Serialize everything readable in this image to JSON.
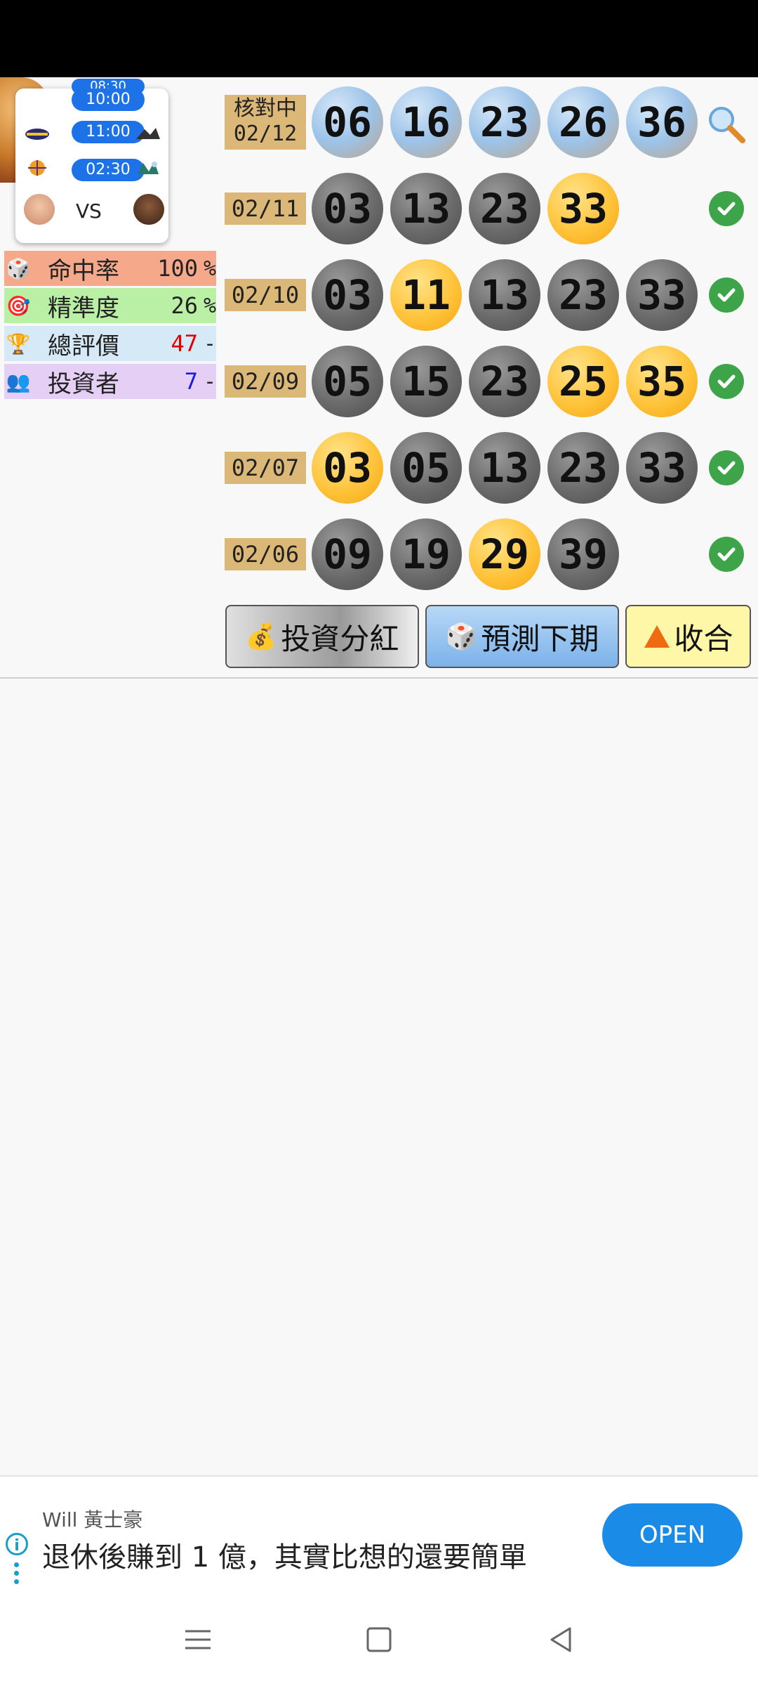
{
  "schedule": {
    "times": [
      "08:30",
      "10:00",
      "11:00",
      "02:30"
    ],
    "vs_label": "VS"
  },
  "stats": [
    {
      "icon": "dice-icon",
      "label": "命中率",
      "value": "100",
      "unit": "%",
      "bg": "#f6a88a",
      "value_color": "#222222"
    },
    {
      "icon": "target-icon",
      "label": "精準度",
      "value": "26",
      "unit": "%",
      "bg": "#b9f0a6",
      "value_color": "#222222"
    },
    {
      "icon": "trophy-icon",
      "label": "總評價",
      "value": "47",
      "unit": "-",
      "bg": "#d6e9f7",
      "value_color": "#e00000"
    },
    {
      "icon": "people-icon",
      "label": "投資者",
      "value": "7",
      "unit": "-",
      "bg": "#e6cff4",
      "value_color": "#1a1adc"
    }
  ],
  "draws": [
    {
      "date_top": "核對中",
      "date": "02/12",
      "balls": [
        "06",
        "16",
        "23",
        "26",
        "36"
      ],
      "colors": [
        "blue",
        "blue",
        "blue",
        "blue",
        "blue"
      ],
      "status": "search-icon"
    },
    {
      "date": "02/11",
      "balls": [
        "03",
        "13",
        "23",
        "33"
      ],
      "colors": [
        "gray",
        "gray",
        "gray",
        "gold"
      ],
      "status": "check-icon"
    },
    {
      "date": "02/10",
      "balls": [
        "03",
        "11",
        "13",
        "23",
        "33"
      ],
      "colors": [
        "gray",
        "gold",
        "gray",
        "gray",
        "gray"
      ],
      "status": "check-icon"
    },
    {
      "date": "02/09",
      "balls": [
        "05",
        "15",
        "23",
        "25",
        "35"
      ],
      "colors": [
        "gray",
        "gray",
        "gray",
        "gold",
        "gold"
      ],
      "status": "check-icon"
    },
    {
      "date": "02/07",
      "balls": [
        "03",
        "05",
        "13",
        "23",
        "33"
      ],
      "colors": [
        "gold",
        "gray",
        "gray",
        "gray",
        "gray"
      ],
      "status": "check-icon"
    },
    {
      "date": "02/06",
      "balls": [
        "09",
        "19",
        "29",
        "39"
      ],
      "colors": [
        "gray",
        "gray",
        "gold",
        "gray"
      ],
      "status": "check-icon"
    }
  ],
  "buttons": {
    "invest": "投資分紅",
    "predict": "預測下期",
    "collapse": "收合"
  },
  "ad": {
    "brand": "Will 黃士豪",
    "text": "退休後賺到 1 億，其實比想的還要簡單",
    "open": "OPEN"
  },
  "colors": {
    "date_tag": "#dcb878",
    "gold_ball": "#ffc33a",
    "gray_ball": "#6a6a6a",
    "check": "#3ea44a",
    "open_button": "#1a8be6",
    "pill": "#1e72e8"
  }
}
